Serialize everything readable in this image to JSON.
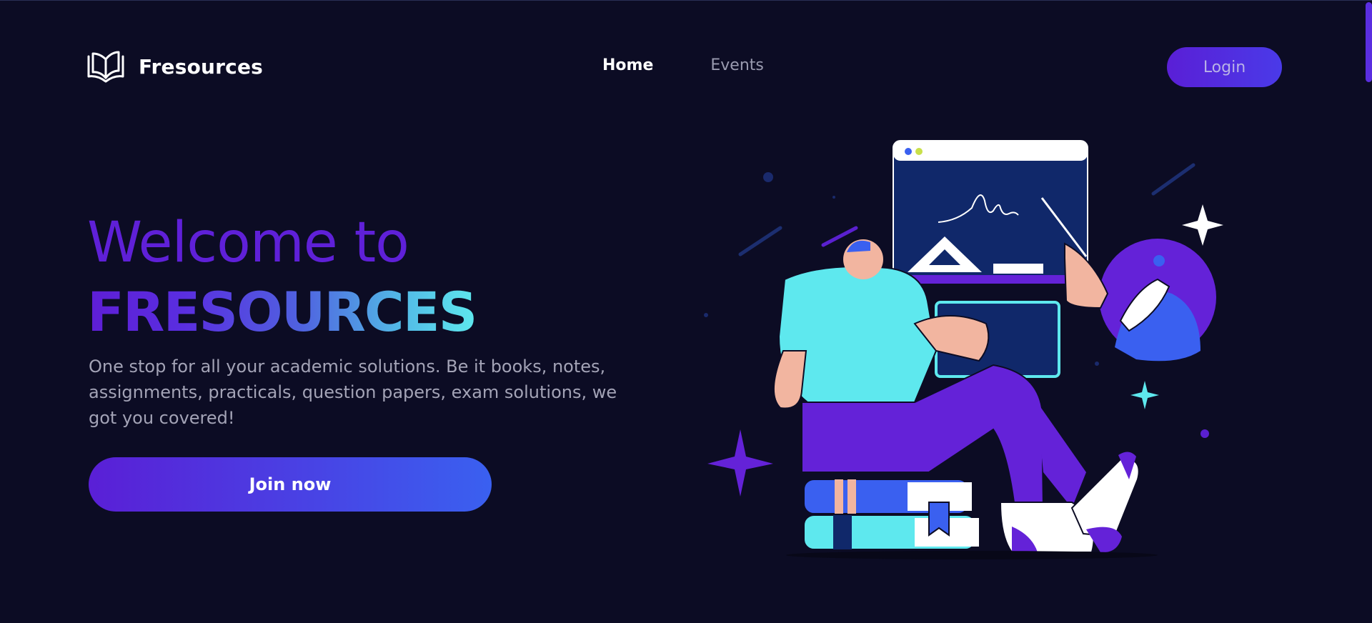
{
  "brand": {
    "name": "Fresources",
    "logo_icon": "open-book-icon"
  },
  "nav": {
    "items": [
      {
        "label": "Home",
        "active": true
      },
      {
        "label": "Events",
        "active": false
      }
    ],
    "login_label": "Login"
  },
  "hero": {
    "welcome": "Welcome to",
    "title": "FRESOURCES",
    "tagline": "One stop for all your academic solutions. Be it books, notes, assignments, practicals, question papers, exam solutions, we got you covered!",
    "cta_label": "Join now"
  },
  "colors": {
    "background": "#0c0c24",
    "accent_purple": "#5f20d8",
    "accent_blue": "#3a60f0",
    "accent_cyan": "#5ee8ee"
  }
}
